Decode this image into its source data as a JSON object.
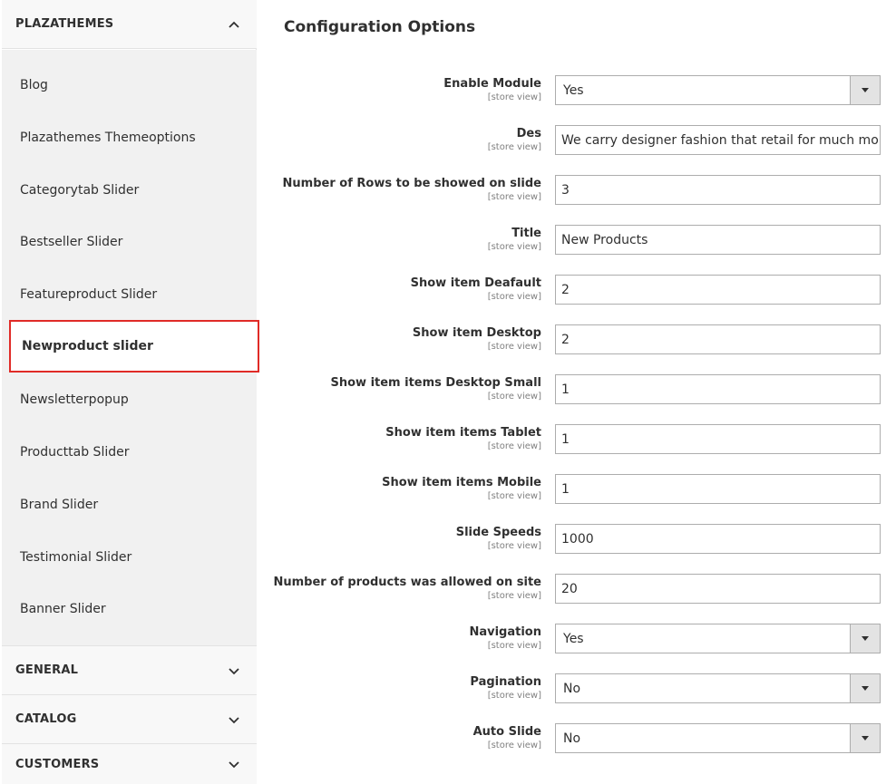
{
  "sidebar": {
    "sections": [
      {
        "label": "PLAZATHEMES",
        "expanded": true,
        "icon": "chevron-up-icon"
      },
      {
        "label": "GENERAL",
        "expanded": false,
        "icon": "chevron-down-icon"
      },
      {
        "label": "CATALOG",
        "expanded": false,
        "icon": "chevron-down-icon"
      },
      {
        "label": "CUSTOMERS",
        "expanded": false,
        "icon": "chevron-down-icon"
      }
    ],
    "items": [
      {
        "label": "Blog"
      },
      {
        "label": "Plazathemes Themeoptions"
      },
      {
        "label": "Categorytab Slider"
      },
      {
        "label": "Bestseller Slider"
      },
      {
        "label": "Featureproduct Slider"
      },
      {
        "label": "Newproduct slider",
        "active": true
      },
      {
        "label": "Newsletterpopup"
      },
      {
        "label": "Producttab Slider"
      },
      {
        "label": "Brand Slider"
      },
      {
        "label": "Testimonial Slider"
      },
      {
        "label": "Banner Slider"
      }
    ]
  },
  "main": {
    "title": "Configuration Options",
    "fields": [
      {
        "label": "Enable Module",
        "scope": "[store view]",
        "type": "select",
        "value": "Yes"
      },
      {
        "label": "Des",
        "scope": "[store view]",
        "type": "text",
        "value": "We carry designer fashion that retail for much more a"
      },
      {
        "label": "Number of Rows to be showed on slide",
        "scope": "[store view]",
        "type": "text",
        "value": "3"
      },
      {
        "label": "Title",
        "scope": "[store view]",
        "type": "text",
        "value": "New Products"
      },
      {
        "label": "Show item Deafault",
        "scope": "[store view]",
        "type": "text",
        "value": "2"
      },
      {
        "label": "Show item Desktop",
        "scope": "[store view]",
        "type": "text",
        "value": "2"
      },
      {
        "label": "Show item items Desktop Small",
        "scope": "[store view]",
        "type": "text",
        "value": "1"
      },
      {
        "label": "Show item items Tablet",
        "scope": "[store view]",
        "type": "text",
        "value": "1"
      },
      {
        "label": "Show item items Mobile",
        "scope": "[store view]",
        "type": "text",
        "value": "1"
      },
      {
        "label": "Slide Speeds",
        "scope": "[store view]",
        "type": "text",
        "value": "1000"
      },
      {
        "label": "Number of products was allowed on site",
        "scope": "[store view]",
        "type": "text",
        "value": "20"
      },
      {
        "label": "Navigation",
        "scope": "[store view]",
        "type": "select",
        "value": "Yes"
      },
      {
        "label": "Pagination",
        "scope": "[store view]",
        "type": "select",
        "value": "No"
      },
      {
        "label": "Auto Slide",
        "scope": "[store view]",
        "type": "select",
        "value": "No"
      }
    ]
  },
  "colors": {
    "active_border": "#e02b27",
    "sidebar_bg": "#f1f1f1",
    "field_border": "#adadad"
  }
}
